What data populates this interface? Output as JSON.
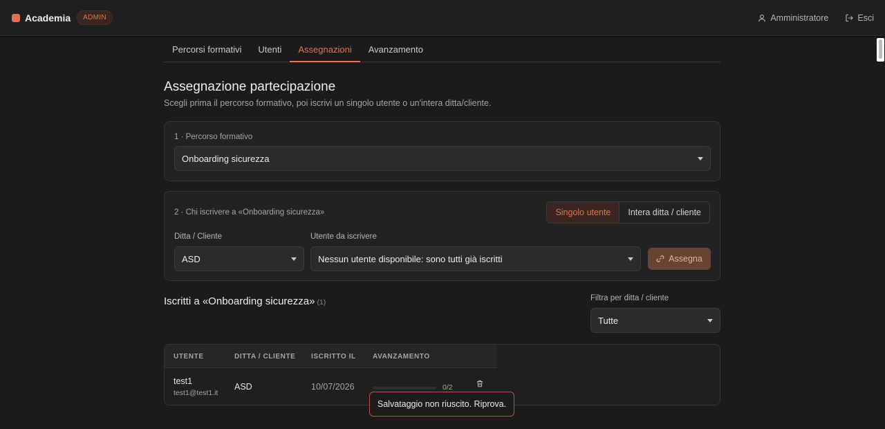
{
  "app": {
    "name": "Academia",
    "badge": "ADMIN"
  },
  "header": {
    "user_label": "Amministratore",
    "logout_label": "Esci"
  },
  "tabs": [
    {
      "label": "Percorsi formativi",
      "active": false
    },
    {
      "label": "Utenti",
      "active": false
    },
    {
      "label": "Assegnazioni",
      "active": true
    },
    {
      "label": "Avanzamento",
      "active": false
    }
  ],
  "page": {
    "title": "Assegnazione partecipazione",
    "subtitle": "Scegli prima il percorso formativo, poi iscrivi un singolo utente o un'intera ditta/cliente."
  },
  "step1": {
    "label": "1 · Percorso formativo",
    "selected": "Onboarding sicurezza"
  },
  "step2": {
    "label": "2 · Chi iscrivere a «Onboarding sicurezza»",
    "mode_single": "Singolo utente",
    "mode_company": "Intera ditta / cliente",
    "company_label": "Ditta / Cliente",
    "company_value": "ASD",
    "user_label": "Utente da iscrivere",
    "user_value": "Nessun utente disponibile: sono tutti già iscritti",
    "assign_label": "Assegna"
  },
  "enrolled": {
    "title": "Iscritti a «Onboarding sicurezza»",
    "count": "(1)",
    "filter_label": "Filtra per ditta / cliente",
    "filter_value": "Tutte",
    "columns": [
      "UTENTE",
      "DITTA / CLIENTE",
      "ISCRITTO IL",
      "AVANZAMENTO"
    ],
    "rows": [
      {
        "name": "test1",
        "email": "test1@test1.it",
        "company": "ASD",
        "date": "10/07/2026",
        "progress_text": "0/2",
        "progress_fraction": 0
      }
    ]
  },
  "toast": {
    "message": "Salvataggio non riuscito. Riprova."
  },
  "colors": {
    "accent": "#e0764f",
    "background": "#1b1b1b",
    "error_border": "#b5533e"
  }
}
